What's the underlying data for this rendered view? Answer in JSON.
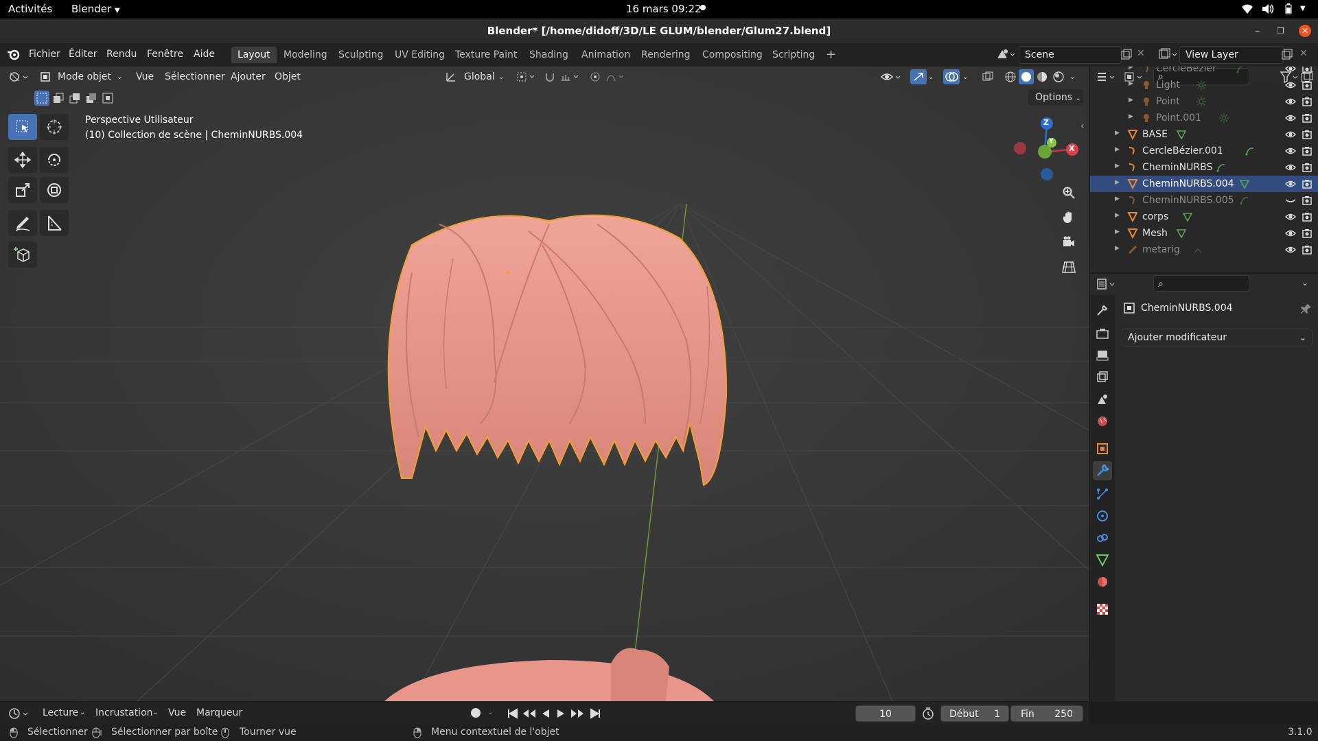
{
  "system": {
    "activities": "Activités",
    "app": "Blender",
    "datetime": "16 mars  09:22"
  },
  "window": {
    "title": "Blender* [/home/didoff/3D/LE GLUM/blender/Glum27.blend]"
  },
  "menu": {
    "items": [
      "Fichier",
      "Éditer",
      "Rendu",
      "Fenêtre",
      "Aide"
    ]
  },
  "workspaces": {
    "tabs": [
      "Layout",
      "Modeling",
      "Sculpting",
      "UV Editing",
      "Texture Paint",
      "Shading",
      "Animation",
      "Rendering",
      "Compositing",
      "Scripting"
    ],
    "active": "Layout",
    "add": "+"
  },
  "scene": {
    "label": "Scene"
  },
  "view_layer": {
    "label": "View Layer"
  },
  "viewport": {
    "mode": "Mode objet",
    "menus": [
      "Vue",
      "Sélectionner",
      "Ajouter",
      "Objet"
    ],
    "transform": "Global",
    "options": "Options",
    "view_name": "Perspective Utilisateur",
    "collection_info": "(10) Collection de scène | CheminNURBS.004",
    "axes": {
      "x": "X",
      "y": "Y",
      "z": "Z"
    }
  },
  "outliner": {
    "rows": [
      {
        "name": "CercleBézier",
        "icon": "curve-icon",
        "dim": true
      },
      {
        "name": "Light",
        "icon": "light-icon",
        "dim": true
      },
      {
        "name": "Point",
        "icon": "light-icon",
        "dim": true
      },
      {
        "name": "Point.001",
        "icon": "light-icon",
        "dim": true
      },
      {
        "name": "BASE",
        "icon": "mesh-icon",
        "dim": false
      },
      {
        "name": "CercleBézier.001",
        "icon": "curve-icon",
        "dim": false
      },
      {
        "name": "CheminNURBS",
        "icon": "curve-icon",
        "dim": false
      },
      {
        "name": "CheminNURBS.004",
        "icon": "mesh-icon",
        "dim": false,
        "selected": true
      },
      {
        "name": "CheminNURBS.005",
        "icon": "curve-icon",
        "dim": true
      },
      {
        "name": "corps",
        "icon": "mesh-icon",
        "dim": false
      },
      {
        "name": "Mesh",
        "icon": "mesh-icon",
        "dim": false
      },
      {
        "name": "metarig",
        "icon": "armature-icon",
        "dim": true
      }
    ]
  },
  "properties": {
    "object_name": "CheminNURBS.004",
    "add_modifier": "Ajouter modificateur"
  },
  "timeline": {
    "menus": [
      "Lecture",
      "Incrustation",
      "Vue",
      "Marqueur"
    ],
    "current_frame": "10",
    "start_label": "Début",
    "start_value": "1",
    "end_label": "Fin",
    "end_value": "250"
  },
  "status": {
    "select": "Sélectionner",
    "box_select": "Sélectionner par boîte",
    "rotate": "Tourner vue",
    "context_menu": "Menu contextuel de l'objet",
    "version": "3.1.0"
  },
  "colors": {
    "selection": "#4772b3",
    "hair": "#e8958a",
    "outline": "#f0a030"
  }
}
